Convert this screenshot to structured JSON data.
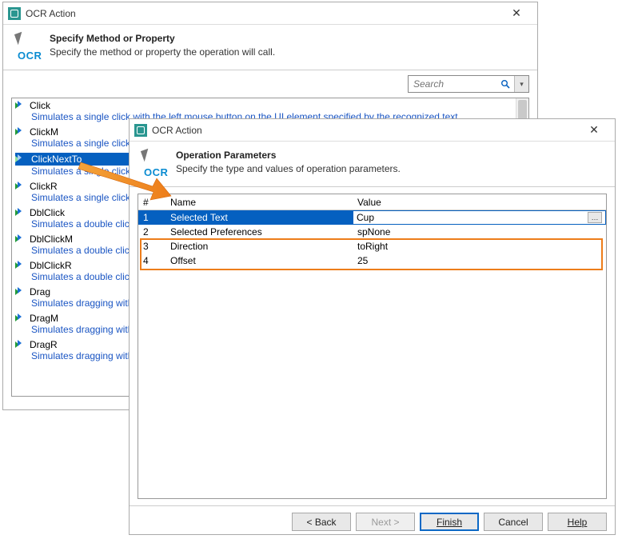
{
  "window1": {
    "title": "OCR Action",
    "header_title": "Specify Method or Property",
    "header_desc": "Specify the method or property the operation will call.",
    "search_placeholder": "Search",
    "methods": [
      {
        "name": "Click",
        "desc": "Simulates a single click with the left mouse button on the UI element specified by the recognized text."
      },
      {
        "name": "ClickM",
        "desc": "Simulates a single click with the middle mouse button on the UI element specified by the recognized text."
      },
      {
        "name": "ClickNextTo",
        "desc": "Simulates a single click with the left mouse button on the UI element near the recognized text.",
        "selected": true
      },
      {
        "name": "ClickR",
        "desc": "Simulates a single click with the right mouse button on the UI element specified by the recognized text."
      },
      {
        "name": "DblClick",
        "desc": "Simulates a double click with the left mouse button on the UI element specified by the recognized text."
      },
      {
        "name": "DblClickM",
        "desc": "Simulates a double click with the middle mouse button on the UI element specified by the recognized text."
      },
      {
        "name": "DblClickR",
        "desc": "Simulates a double click with the right mouse button on the UI element specified by the recognized text."
      },
      {
        "name": "Drag",
        "desc": "Simulates dragging with the left mouse button on the UI element specified by the recognized text."
      },
      {
        "name": "DragM",
        "desc": "Simulates dragging with the middle mouse button on the UI element specified by the recognized text."
      },
      {
        "name": "DragR",
        "desc": "Simulates dragging with the right mouse button on the UI element specified by the recognized text."
      }
    ]
  },
  "window2": {
    "title": "OCR Action",
    "header_title": "Operation Parameters",
    "header_desc": "Specify the type and values of operation parameters.",
    "columns": {
      "num": "#",
      "name": "Name",
      "value": "Value"
    },
    "rows": [
      {
        "num": "1",
        "name": "Selected Text",
        "value": "Cup",
        "selected": true
      },
      {
        "num": "2",
        "name": "Selected Preferences",
        "value": "spNone"
      },
      {
        "num": "3",
        "name": "Direction",
        "value": "toRight"
      },
      {
        "num": "4",
        "name": "Offset",
        "value": "25"
      }
    ],
    "buttons": {
      "back": "< Back",
      "next": "Next >",
      "finish": "Finish",
      "cancel": "Cancel",
      "help": "Help"
    }
  },
  "ocr_label": "OCR"
}
